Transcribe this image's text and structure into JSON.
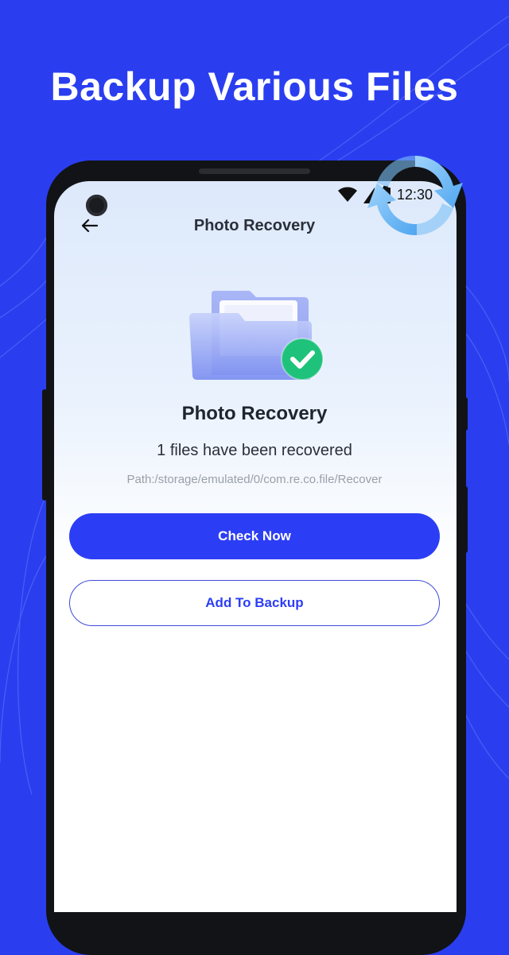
{
  "promo": {
    "headline": "Backup Various Files"
  },
  "status_bar": {
    "time": "12:30"
  },
  "nav": {
    "title": "Photo Recovery",
    "back_icon": "arrow-left-icon"
  },
  "result": {
    "title": "Photo Recovery",
    "subtitle": "1 files have been recovered",
    "path": "Path:/storage/emulated/0/com.re.co.file/Recover"
  },
  "actions": {
    "check_now": "Check Now",
    "add_backup": "Add To Backup"
  },
  "colors": {
    "background": "#2a3ef0",
    "primary": "#2c3ef5",
    "success": "#1fc27a"
  }
}
